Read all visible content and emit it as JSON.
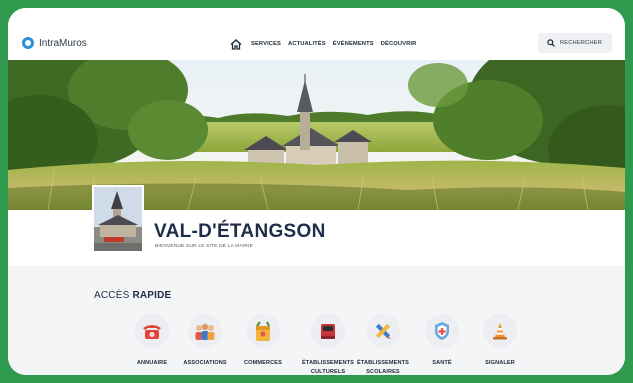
{
  "brand": {
    "name": "IntraMuros"
  },
  "nav": {
    "items": [
      "SERVICES",
      "ACTUALITÉS",
      "ÉVÉNEMENTS",
      "DÉCOUVRIR"
    ],
    "search_label": "RECHERCHER"
  },
  "town": {
    "name": "VAL-D'ÉTANGSON",
    "subtitle": "BIENVENUE SUR LE SITE DE LA MAIRIE"
  },
  "quick_access": {
    "title_light": "ACCÈS ",
    "title_bold": "RAPIDE",
    "items": [
      {
        "label": "ANNUAIRE",
        "icon": "telephone-icon"
      },
      {
        "label": "ASSOCIATIONS",
        "icon": "people-icon"
      },
      {
        "label": "COMMERCES",
        "icon": "shopping-bag-icon"
      },
      {
        "label": "ÉTABLISSEMENTS\nCULTURELS",
        "icon": "book-icon"
      },
      {
        "label": "ÉTABLISSEMENTS\nSCOLAIRES",
        "icon": "pencil-ruler-icon"
      },
      {
        "label": "SANTÉ",
        "icon": "health-shield-icon"
      },
      {
        "label": "SIGNALER",
        "icon": "traffic-cone-icon"
      }
    ]
  },
  "colors": {
    "frame_green": "#2f9a4e",
    "title_navy": "#1e2d48",
    "brand_blue": "#2a8fd6"
  }
}
